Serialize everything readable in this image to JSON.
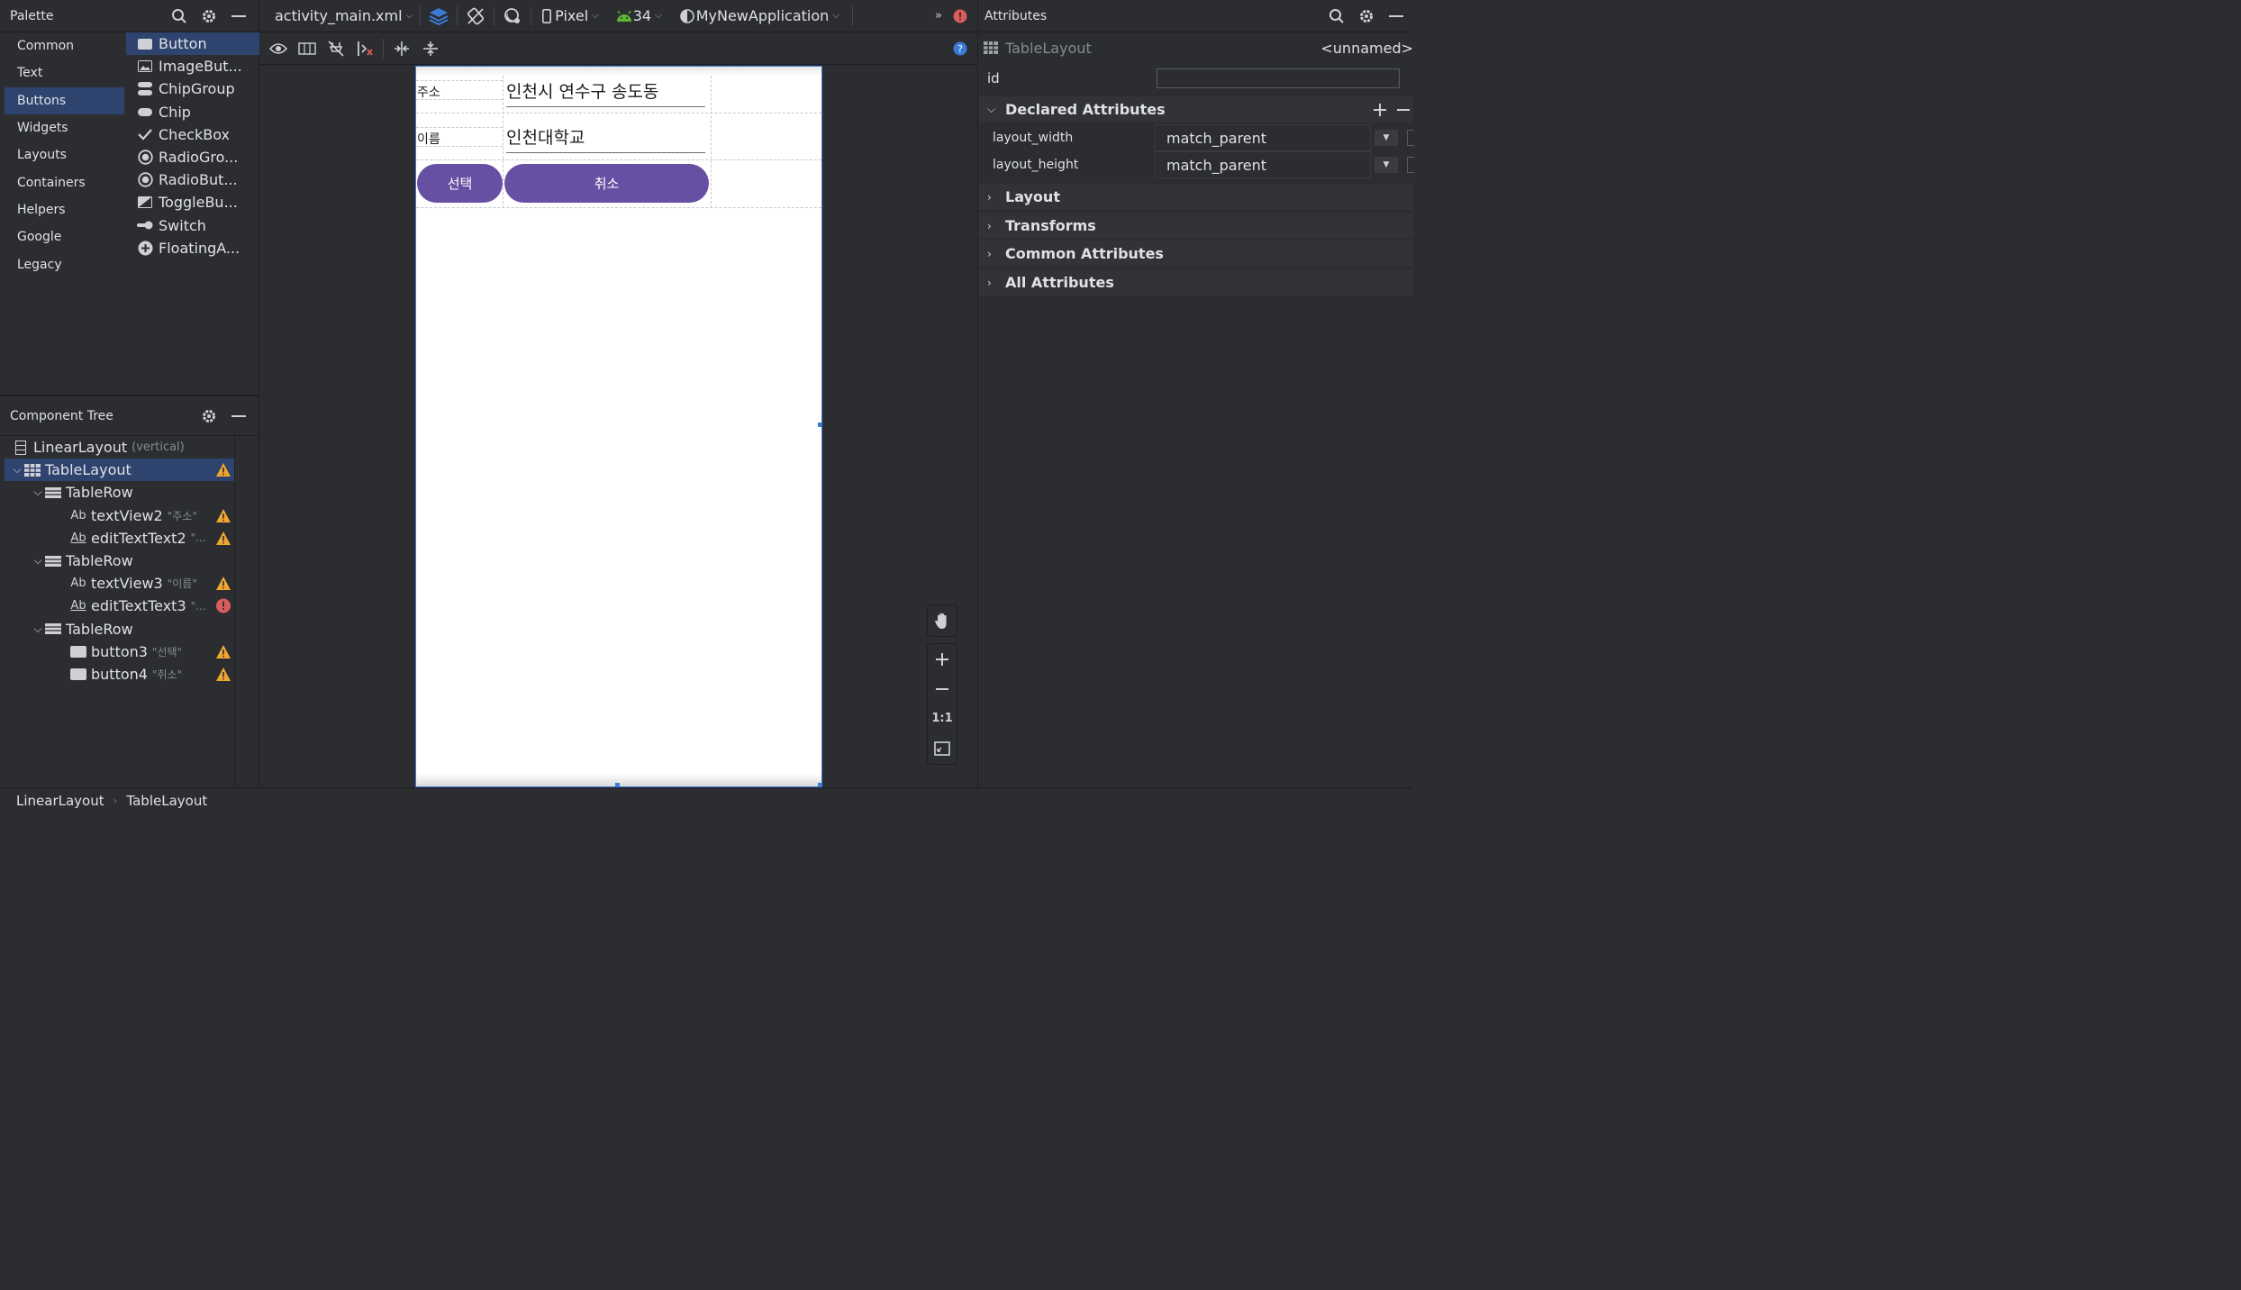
{
  "palette": {
    "title": "Palette",
    "categories": [
      "Common",
      "Text",
      "Buttons",
      "Widgets",
      "Layouts",
      "Containers",
      "Helpers",
      "Google",
      "Legacy"
    ],
    "selected_category": "Buttons",
    "widgets": [
      {
        "label": "Button",
        "icon": "button-icon"
      },
      {
        "label": "ImageBut...",
        "icon": "image-button-icon"
      },
      {
        "label": "ChipGroup",
        "icon": "chipgroup-icon"
      },
      {
        "label": "Chip",
        "icon": "chip-icon"
      },
      {
        "label": "CheckBox",
        "icon": "checkbox-icon"
      },
      {
        "label": "RadioGro...",
        "icon": "radiogroup-icon"
      },
      {
        "label": "RadioBut...",
        "icon": "radiobutton-icon"
      },
      {
        "label": "ToggleBu...",
        "icon": "togglebutton-icon"
      },
      {
        "label": "Switch",
        "icon": "switch-icon"
      },
      {
        "label": "FloatingA...",
        "icon": "fab-icon"
      }
    ]
  },
  "component_tree": {
    "title": "Component Tree",
    "root_label": "LinearLayout",
    "root_sub": "(vertical)",
    "table_label": "TableLayout",
    "row_label": "TableRow",
    "children": [
      {
        "name": "textView2",
        "hint": "\"주소\"",
        "badge": "warning"
      },
      {
        "name": "editTextText2",
        "hint": "\"...",
        "badge": "warning"
      },
      {
        "name": "textView3",
        "hint": "\"이름\"",
        "badge": "warning"
      },
      {
        "name": "editTextText3",
        "hint": "\"...",
        "badge": "error"
      },
      {
        "name": "button3",
        "hint": "\"선택\"",
        "badge": "warning"
      },
      {
        "name": "button4",
        "hint": "\"취소\"",
        "badge": "warning"
      }
    ]
  },
  "toolbar": {
    "file": "activity_main.xml",
    "device": "Pixel",
    "api": "34",
    "theme": "MyNewApplication"
  },
  "preview": {
    "row1_label": "주소",
    "row1_value": "인천시 연수구 송도동",
    "row2_label": "이름",
    "row2_value": "인천대학교",
    "button_select": "선택",
    "button_cancel": "취소",
    "button_color": "#6750a4"
  },
  "zoom": {
    "one_to_one": "1:1"
  },
  "attributes": {
    "title": "Attributes",
    "component": "TableLayout",
    "component_name": "<unnamed>",
    "id_label": "id",
    "id_value": "",
    "declared_title": "Declared Attributes",
    "declared": [
      {
        "key": "layout_width",
        "value": "match_parent"
      },
      {
        "key": "layout_height",
        "value": "match_parent"
      }
    ],
    "sections": [
      "Layout",
      "Transforms",
      "Common Attributes",
      "All Attributes"
    ]
  },
  "statusbar": {
    "crumbs": [
      "LinearLayout",
      "TableLayout"
    ]
  },
  "colors": {
    "selection": "#2e436e",
    "warning": "#f0a732",
    "error": "#db5c5c",
    "accent_blue": "#3b7bd6"
  }
}
